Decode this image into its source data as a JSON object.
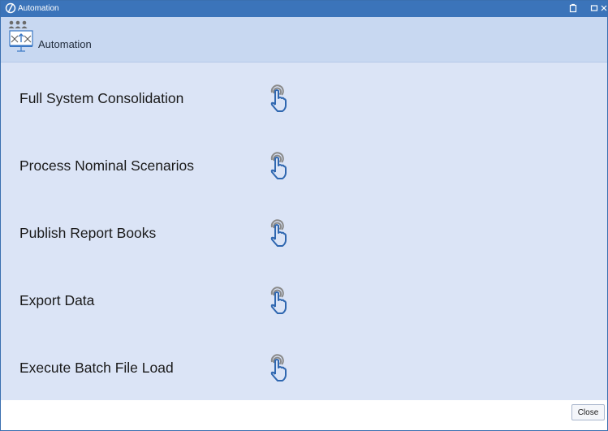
{
  "window": {
    "title": "Automation"
  },
  "header": {
    "title": "Automation",
    "icon": "people-upload-icon"
  },
  "items": [
    {
      "label": "Full System Consolidation",
      "icon": "tap-gesture-icon"
    },
    {
      "label": "Process Nominal Scenarios",
      "icon": "tap-gesture-icon"
    },
    {
      "label": "Publish Report Books",
      "icon": "tap-gesture-icon"
    },
    {
      "label": "Export Data",
      "icon": "tap-gesture-icon"
    },
    {
      "label": "Execute Batch File Load",
      "icon": "tap-gesture-icon"
    }
  ],
  "footer": {
    "close_label": "Close"
  },
  "colors": {
    "titlebar": "#3b74ba",
    "header": "#c8d8f1",
    "content": "#dbe4f6",
    "icon_blue": "#2f67b0",
    "icon_gray": "#8a8a8a"
  }
}
